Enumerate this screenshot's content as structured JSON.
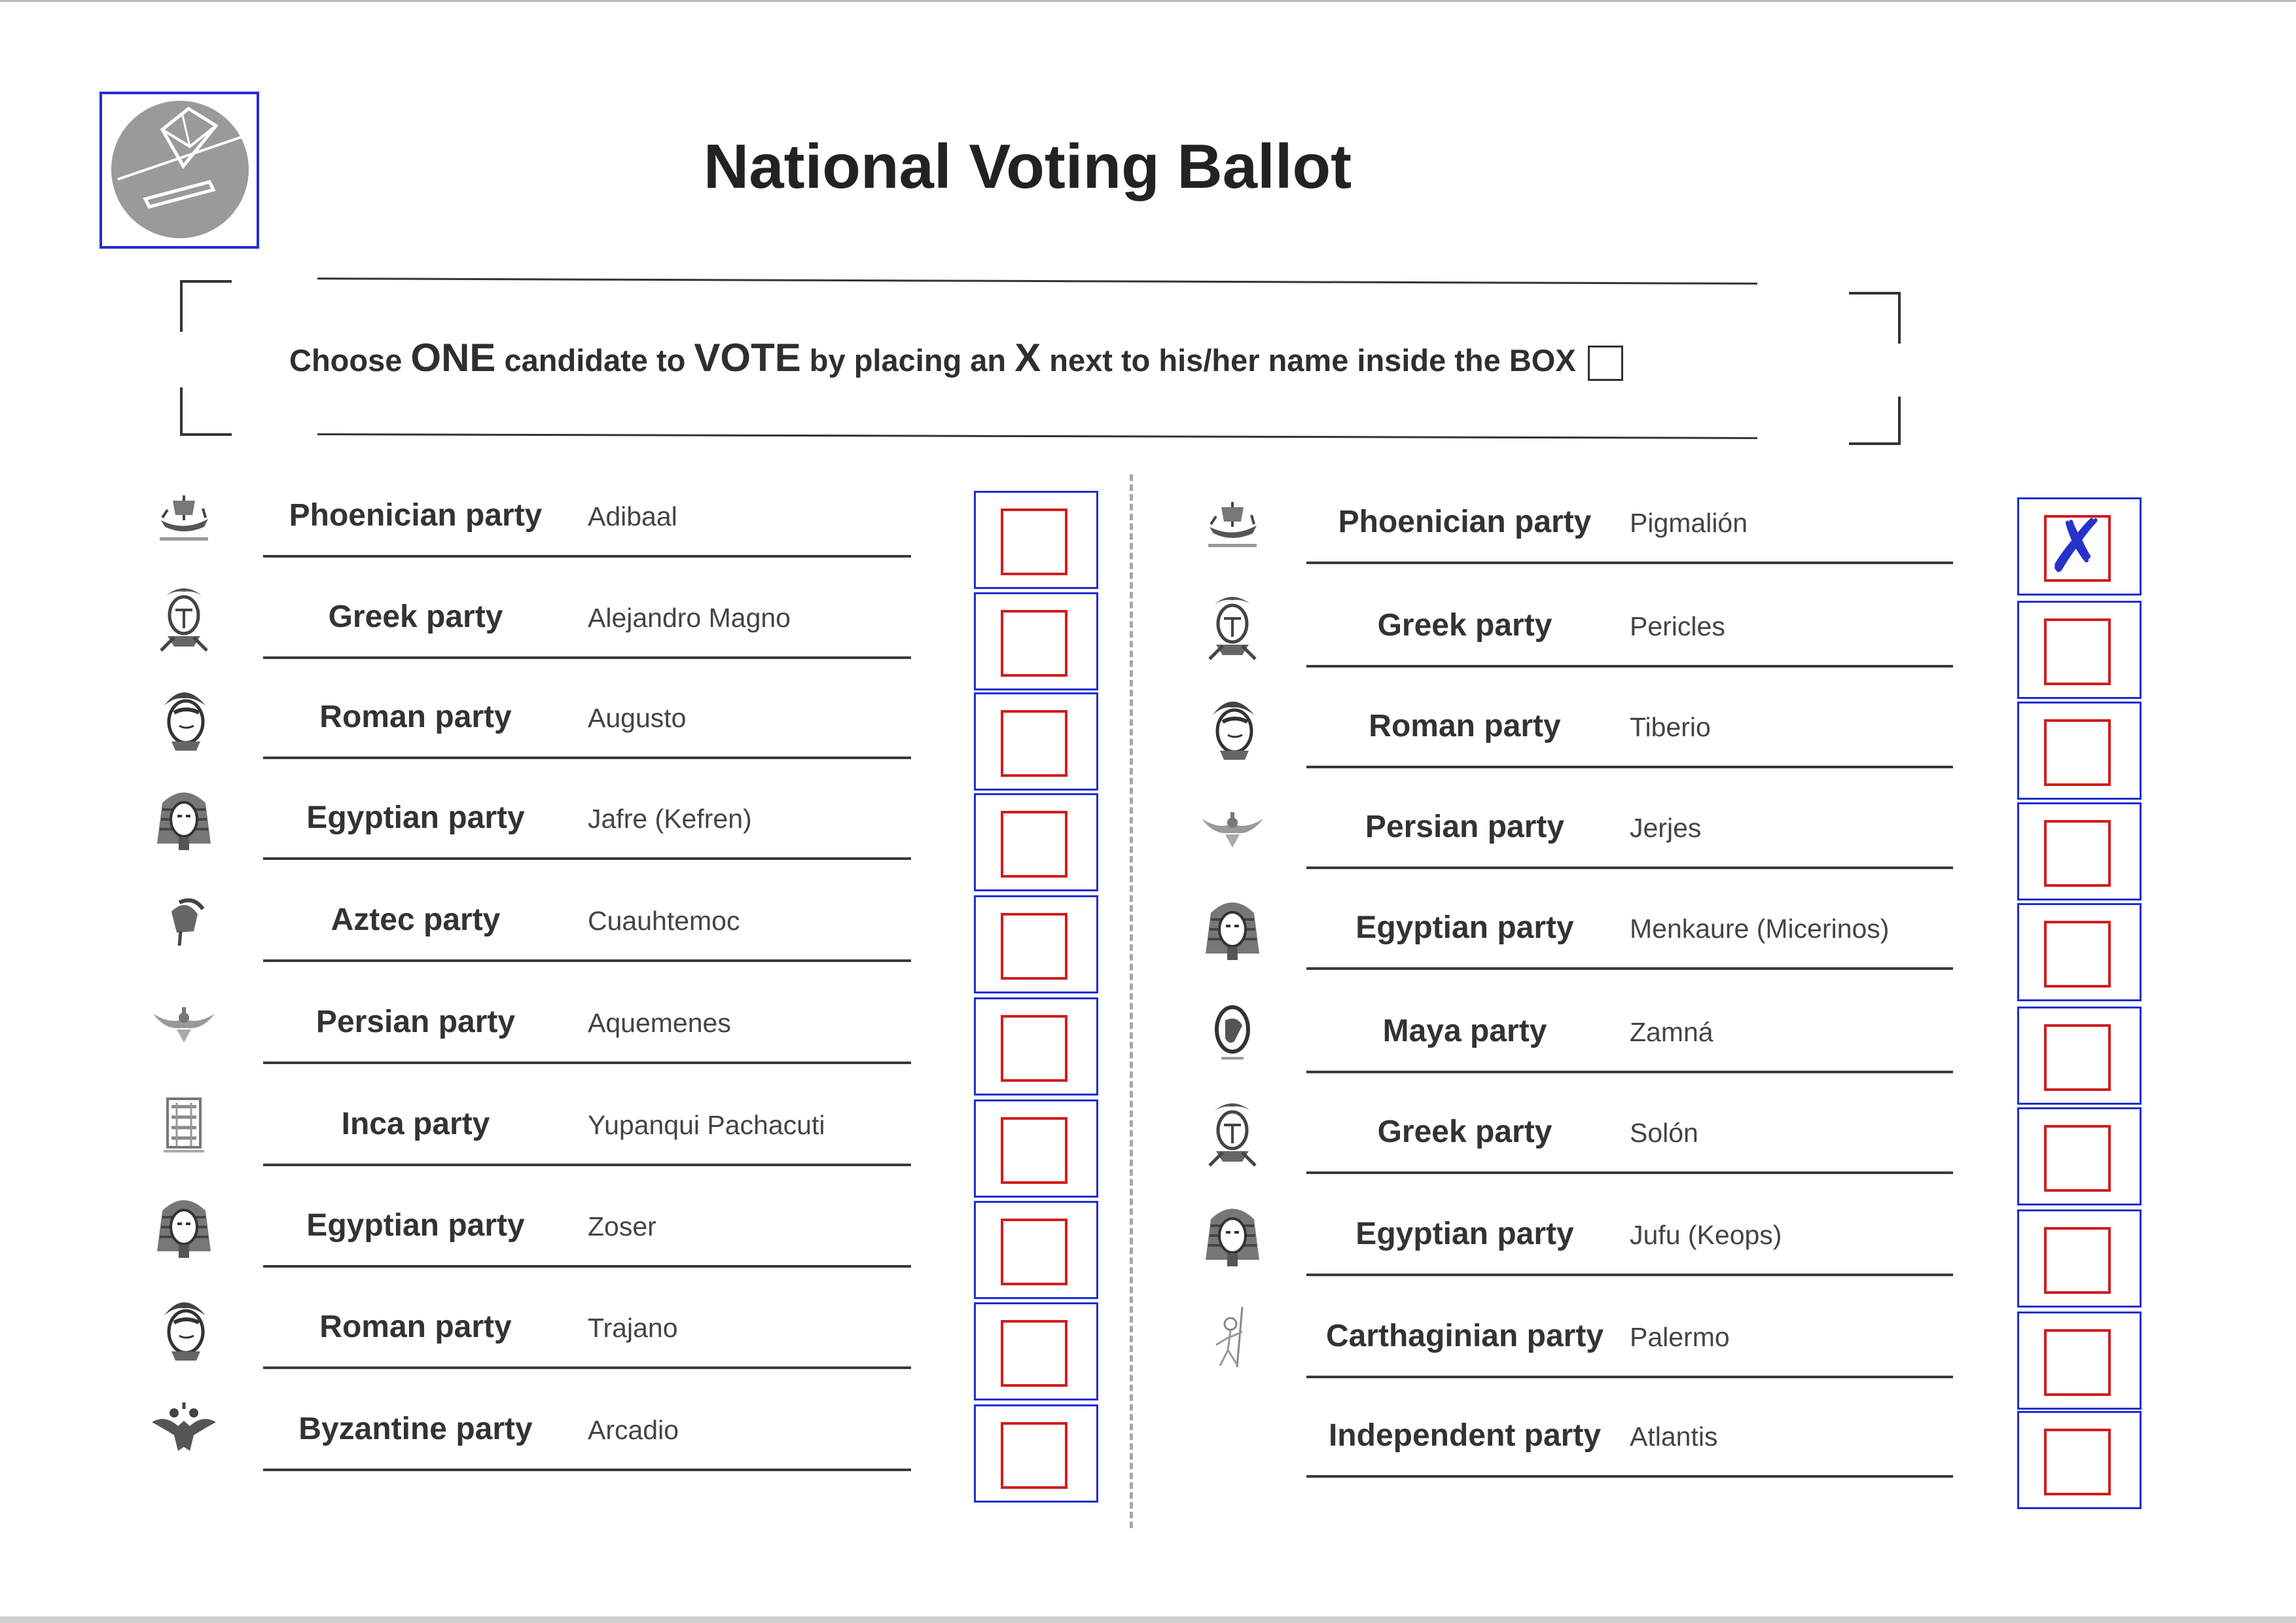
{
  "ballot": {
    "title": "National Voting Ballot",
    "instruction": {
      "part1": "Choose ",
      "one": "ONE",
      "part2": " candidate to ",
      "vote": "VOTE",
      "part3": " by placing an ",
      "x": "X",
      "part4": " next to his/her name inside the BOX"
    },
    "logo_icon": "ballot-box-logo-icon",
    "left_column": [
      {
        "party": "Phoenician party",
        "candidate": "Adibaal",
        "icon": "phoenician-ship-icon",
        "checked": false
      },
      {
        "party": "Greek party",
        "candidate": "Alejandro Magno",
        "icon": "greek-warrior-icon",
        "checked": false
      },
      {
        "party": "Roman party",
        "candidate": "Augusto",
        "icon": "roman-helmet-icon",
        "checked": false
      },
      {
        "party": "Egyptian party",
        "candidate": "Jafre (Kefren)",
        "icon": "pharaoh-mask-icon",
        "checked": false
      },
      {
        "party": "Aztec party",
        "candidate": "Cuauhtemoc",
        "icon": "aztec-warrior-icon",
        "checked": false
      },
      {
        "party": "Persian party",
        "candidate": "Aquemenes",
        "icon": "faravahar-icon",
        "checked": false
      },
      {
        "party": "Inca party",
        "candidate": "Yupanqui Pachacuti",
        "icon": "inca-glyph-icon",
        "checked": false
      },
      {
        "party": "Egyptian party",
        "candidate": "Zoser",
        "icon": "pharaoh-mask-icon",
        "checked": false
      },
      {
        "party": "Roman party",
        "candidate": "Trajano",
        "icon": "roman-helmet-icon",
        "checked": false
      },
      {
        "party": "Byzantine  party",
        "candidate": "Arcadio",
        "icon": "double-headed-eagle-icon",
        "checked": false
      }
    ],
    "right_column": [
      {
        "party": "Phoenician party",
        "candidate": "Pigmalión",
        "icon": "phoenician-ship-icon",
        "checked": true
      },
      {
        "party": "Greek party",
        "candidate": "Pericles",
        "icon": "greek-warrior-icon",
        "checked": false
      },
      {
        "party": "Roman party",
        "candidate": "Tiberio",
        "icon": "roman-helmet-icon",
        "checked": false
      },
      {
        "party": "Persian party",
        "candidate": "Jerjes",
        "icon": "faravahar-icon",
        "checked": false
      },
      {
        "party": "Egyptian party",
        "candidate": "Menkaure (Micerinos)",
        "icon": "pharaoh-mask-icon",
        "checked": false
      },
      {
        "party": "Maya party",
        "candidate": "Zamná",
        "icon": "maya-cameo-icon",
        "checked": false
      },
      {
        "party": "Greek party",
        "candidate": "Solón",
        "icon": "greek-warrior-icon",
        "checked": false
      },
      {
        "party": "Egyptian party",
        "candidate": "Jufu (Keops)",
        "icon": "pharaoh-mask-icon",
        "checked": false
      },
      {
        "party": "Carthaginian party",
        "candidate": "Palermo",
        "icon": "carthaginian-warrior-icon",
        "checked": false
      },
      {
        "party": "Independent  party",
        "candidate": "Atlantis",
        "icon": "",
        "checked": false
      }
    ],
    "mark_glyph": "✗"
  }
}
